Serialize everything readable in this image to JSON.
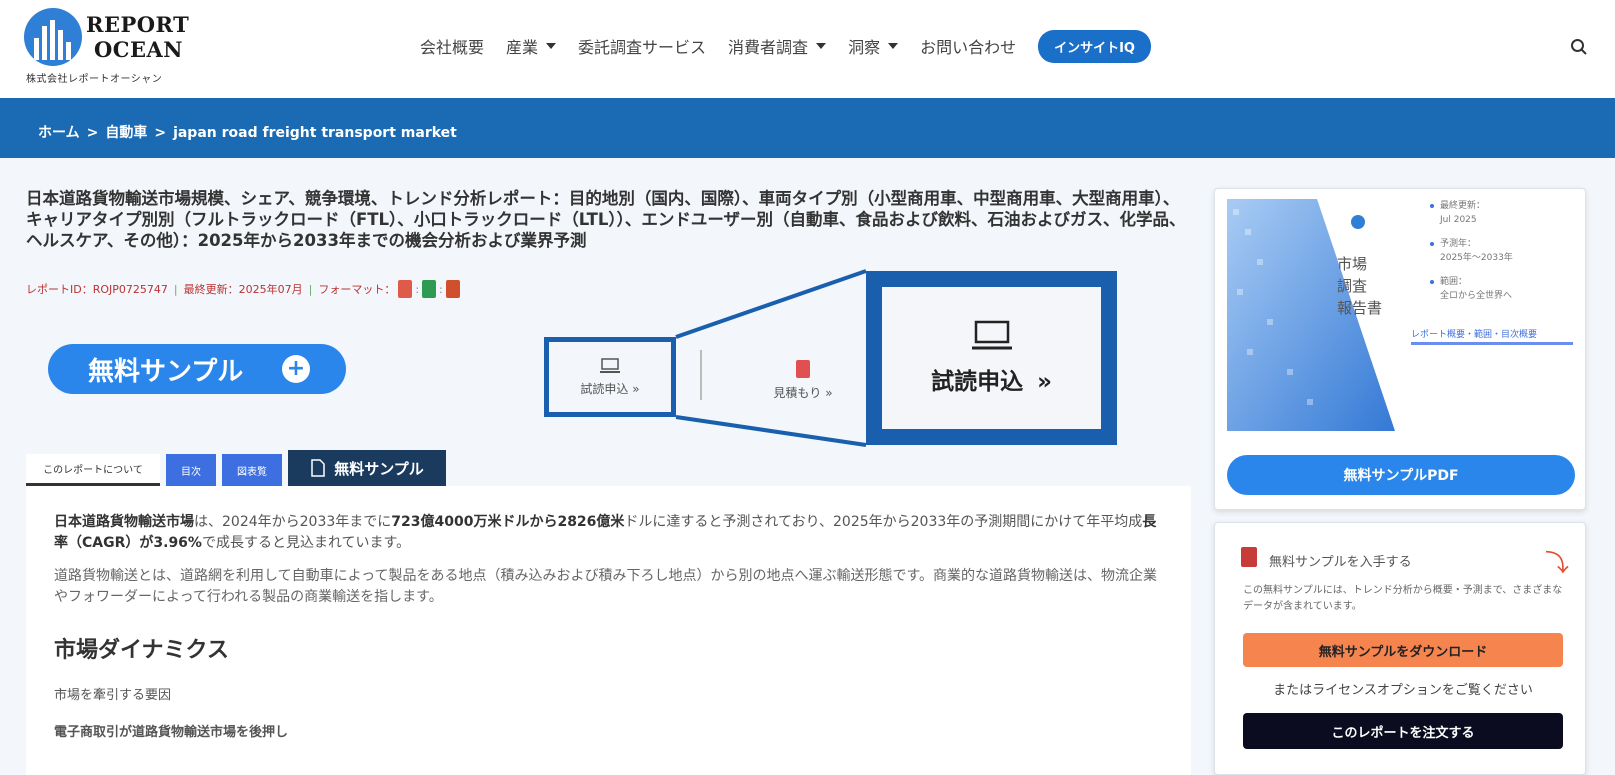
{
  "logo": {
    "line1": "REPORT",
    "line2": "OCEAN",
    "sub": "株式会社レポートオーシャン"
  },
  "nav": {
    "items": [
      "会社概要",
      "産業",
      "委託調査サービス",
      "消費者調査",
      "洞察",
      "お問い合わせ"
    ],
    "pill": "インサイトIQ"
  },
  "breadcrumb": [
    "ホーム",
    "自動車",
    "japan road freight transport market"
  ],
  "report": {
    "title": "日本道路貨物輸送市場規模、シェア、競争環境、トレンド分析レポート：目的地別（国内、国際）、車両タイプ別（小型商用車、中型商用車、大型商用車）、キャリアタイプ別別（フルトラックロード（FTL）、小口トラックロード（LTL））、エンドユーザー別（自動車、食品および飲料、石油およびガス、化学品、ヘルスケア、その他）：2025年から2033年までの機会分析および業界予測",
    "id_label": "レポートID：ROJP0725747",
    "updated_label": "最終更新：2025年07月",
    "format_label": "フォーマット："
  },
  "actions": {
    "free_sample": "無料サンプル",
    "trial": "試読申込",
    "quote": "見積もり",
    "trial_zoom": "試読申込"
  },
  "tabs": {
    "about": "このレポートについて",
    "toc": "目次",
    "list": "図表覧",
    "sample": "無料サンプル"
  },
  "content": {
    "p1_bold_a": "日本道路貨物輸送市場",
    "p1_a": "は、2024年から2033年までに",
    "p1_bold_b": "723億4000万米ドルから2826億米",
    "p1_b": "ドルに達すると予測されており、2025年から2033年の予測期間にかけて年平均成",
    "p1_bold_c": "長率（CAGR）が3.96%",
    "p1_c": "で成長すると見込まれています。",
    "p2": "道路貨物輸送とは、道路網を利用して自動車によって製品をある地点（積み込みおよび積み下ろし地点）から別の地点へ運ぶ輸送形態です。商業的な道路貨物輸送は、物流企業やフォワーダーによって行われる製品の商業輸送を指します。",
    "h2": "市場ダイナミクス",
    "sub1": "市場を牽引する要因",
    "sub2": "電子商取引が道路貨物輸送市場を後押し"
  },
  "sidebar": {
    "cover_title": [
      "市場",
      "調査",
      "報告書"
    ],
    "meta": [
      [
        "最終更新：",
        "Jul 2025"
      ],
      [
        "予測年：",
        "2025年～2033年"
      ],
      [
        "範囲：",
        "全ロから全世界へ"
      ]
    ],
    "link": "レポート概要・範囲・目次概要",
    "pdf_button": "無料サンプルPDF",
    "card2_title": "無料サンプルを入手する",
    "card2_desc": "この無料サンプルには、トレンド分析から概要・予測まで、さまざまなデータが含まれています。",
    "download_button": "無料サンプルをダウンロード",
    "or_text": "またはライセンスオプションをご覧ください",
    "order_button": "このレポートを注文する"
  },
  "colors": {
    "band": "#1a6ab4",
    "primary": "#2a86ea",
    "zoom_border": "#1a5fad",
    "download": "#f5844f",
    "order": "#0b0c1f"
  }
}
